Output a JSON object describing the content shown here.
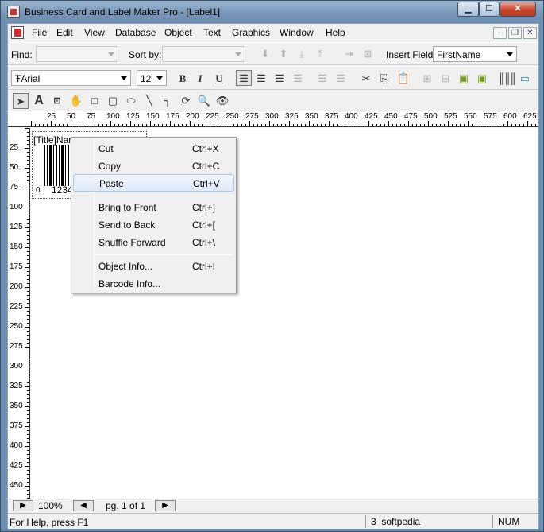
{
  "window": {
    "title": "Business Card and Label Maker Pro - [Label1]",
    "minimize": "▁",
    "maximize": "☐",
    "close": "✕"
  },
  "menubar": {
    "items": [
      "File",
      "Edit",
      "View",
      "Database",
      "Object",
      "Text",
      "Graphics",
      "Window",
      "Help"
    ],
    "mdi_min": "–",
    "mdi_restore": "❐",
    "mdi_close": "✕"
  },
  "findbar": {
    "find_label": "Find:",
    "find_value": "",
    "sortby_label": "Sort by:",
    "sortby_value": "",
    "insert_field_label": "Insert Field:",
    "insert_field_value": "FirstName"
  },
  "formatbar": {
    "font": "Arial",
    "font_icon": "Ŧ",
    "size": "12",
    "bold": "B",
    "italic": "I",
    "underline": "U"
  },
  "ruler": {
    "top_ticks": [
      "25",
      "50",
      "75",
      "100",
      "125",
      "150",
      "175",
      "200",
      "225",
      "250",
      "275",
      "300",
      "325",
      "350",
      "375",
      "400",
      "425",
      "450",
      "475",
      "500",
      "525",
      "550",
      "575",
      "600",
      "625"
    ],
    "left_ticks": [
      "25",
      "50",
      "75",
      "100",
      "125",
      "150",
      "175",
      "200",
      "225",
      "250",
      "275",
      "300",
      "325",
      "350",
      "375",
      "400",
      "425",
      "450"
    ]
  },
  "canvas": {
    "title_field": "[Title]",
    "name_field": "Nam",
    "barcode_text": "1234",
    "zero_text": "0"
  },
  "context_menu": {
    "items": [
      {
        "label": "Cut",
        "shortcut": "Ctrl+X"
      },
      {
        "label": "Copy",
        "shortcut": "Ctrl+C"
      },
      {
        "label": "Paste",
        "shortcut": "Ctrl+V"
      },
      {
        "label": "Bring to Front",
        "shortcut": "Ctrl+]"
      },
      {
        "label": "Send to Back",
        "shortcut": "Ctrl+["
      },
      {
        "label": "Shuffle Forward",
        "shortcut": "Ctrl+\\"
      },
      {
        "label": "Object Info...",
        "shortcut": "Ctrl+I"
      },
      {
        "label": "Barcode Info...",
        "shortcut": ""
      }
    ],
    "highlighted": "Paste"
  },
  "bottombar": {
    "zoom": "100%",
    "page": "pg. 1 of 1",
    "play": "▶",
    "prev": "◀",
    "next": "▶"
  },
  "status": {
    "help": "For Help, press F1",
    "count": "3",
    "brand": "softpedia",
    "num": "NUM"
  }
}
